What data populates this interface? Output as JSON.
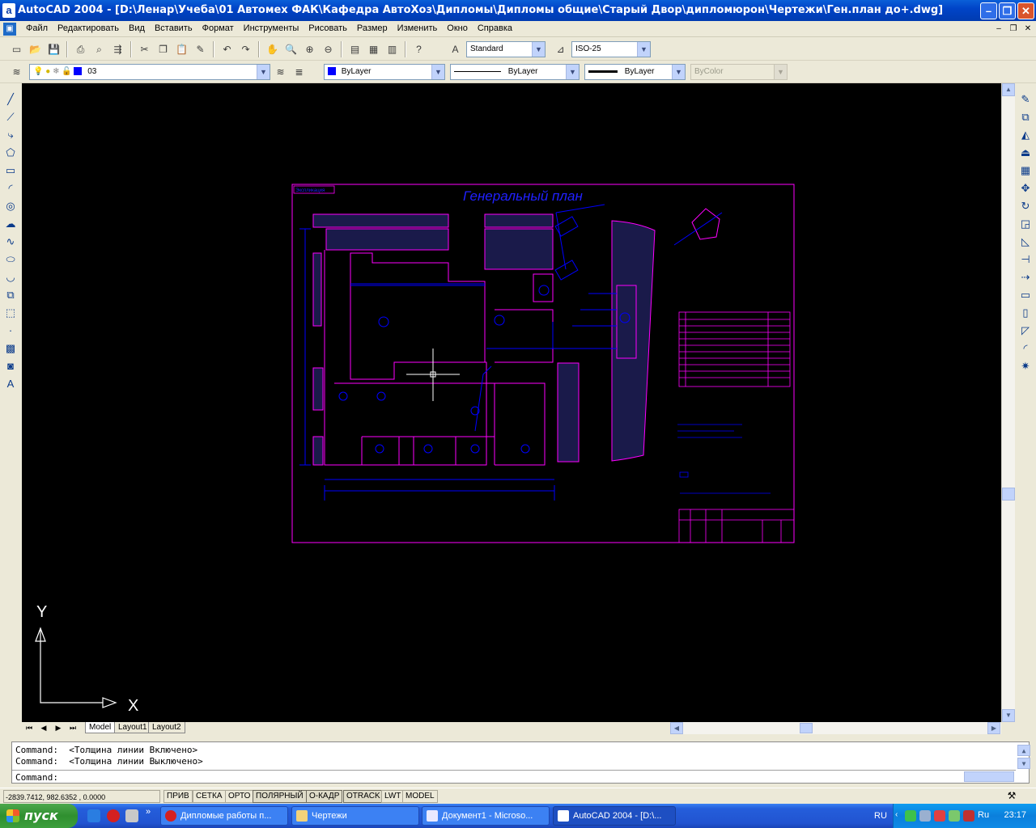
{
  "window": {
    "title": "AutoCAD 2004 - [D:\\Ленар\\Учеба\\01 Автомех ФАК\\Кафедра АвтоХоз\\Дипломы\\Дипломы общие\\Старый Двор\\дипломюрон\\Чертежи\\Ген.план до+.dwg]",
    "app_icon": "a"
  },
  "menu": [
    "Файл",
    "Редактировать",
    "Вид",
    "Вставить",
    "Формат",
    "Инструменты",
    "Рисовать",
    "Размер",
    "Изменить",
    "Окно",
    "Справка"
  ],
  "toolbar_styles": {
    "text_style": "Standard",
    "dim_style": "ISO-25"
  },
  "toolbar_props": {
    "layer": "03",
    "color": "ByLayer",
    "linetype": "ByLayer",
    "lineweight": "ByLayer",
    "plotstyle": "ByColor"
  },
  "colors": {
    "drawing_bg": "#000000",
    "frame": "#ff00ff",
    "drawing_lines": "#0000ff",
    "title_text": "#2020ff"
  },
  "drawing": {
    "title": "Генеральный план",
    "stamp_corner": "Экспликация",
    "ucs_x": "X",
    "ucs_y": "Y"
  },
  "tabs": [
    "Model",
    "Layout1",
    "Layout2"
  ],
  "command_lines": [
    "Command:  <Толщина линии Включено>",
    "Command:  <Толщина линии Выключено>",
    "Command:"
  ],
  "status": {
    "coords": "-2839.7412, 982.6352 , 0.0000",
    "toggles": [
      "ПРИВ",
      "СЕТКА",
      "ОРТО",
      "ПОЛЯРНЫЙ",
      "О-КАДР",
      "OTRACK",
      "LWT",
      "MODEL"
    ]
  },
  "taskbar": {
    "start": "пуск",
    "buttons": [
      {
        "label": "Дипломые работы п...",
        "icon": "opera-icon"
      },
      {
        "label": "Чертежи",
        "icon": "folder-icon"
      },
      {
        "label": "Документ1 - Microso...",
        "icon": "word-icon"
      },
      {
        "label": "AutoCAD 2004 - [D:\\...",
        "icon": "autocad-icon"
      }
    ],
    "lang": "RU",
    "tray_lang": "Ru",
    "clock": "23:17"
  }
}
